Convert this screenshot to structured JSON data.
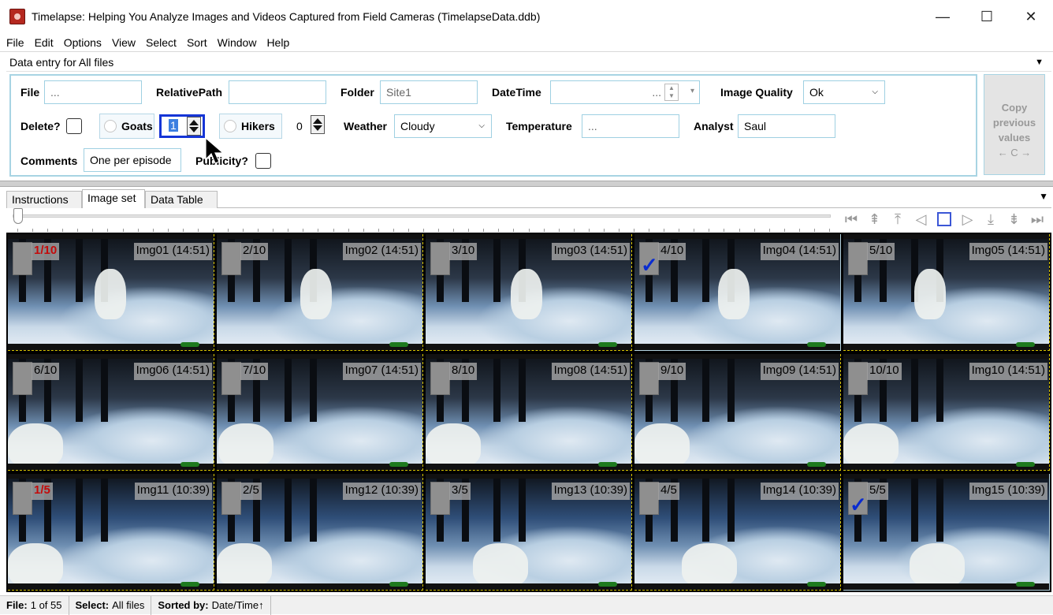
{
  "window": {
    "title": "Timelapse: Helping You Analyze Images and Videos Captured from Field Cameras (TimelapseData.ddb)",
    "controls": [
      "—",
      "☐",
      "✕"
    ]
  },
  "menu": [
    "File",
    "Edit",
    "Options",
    "View",
    "Select",
    "Sort",
    "Window",
    "Help"
  ],
  "data_entry": {
    "header": "Data entry for All files",
    "file": {
      "label": "File",
      "value": "..."
    },
    "relative_path": {
      "label": "RelativePath",
      "value": ""
    },
    "folder": {
      "label": "Folder",
      "value": "Site1"
    },
    "datetime": {
      "label": "DateTime",
      "value": "..."
    },
    "image_quality": {
      "label": "Image Quality",
      "value": "Ok"
    },
    "delete": {
      "label": "Delete?"
    },
    "goats": {
      "label": "Goats",
      "value": "1"
    },
    "hikers": {
      "label": "Hikers",
      "value": "0"
    },
    "weather": {
      "label": "Weather",
      "value": "Cloudy"
    },
    "temperature": {
      "label": "Temperature",
      "value": "..."
    },
    "analyst": {
      "label": "Analyst",
      "value": "Saul"
    },
    "comments": {
      "label": "Comments",
      "value": "One per episode"
    },
    "publicity": {
      "label": "Publicity?"
    },
    "copy_button": {
      "line1": "Copy",
      "line2": "previous",
      "line3": "values",
      "line4": "← C →"
    }
  },
  "tabs": [
    "Instructions",
    "Image set",
    "Data Table"
  ],
  "nav_icons": [
    "first-icon",
    "page-up-icon",
    "row-up-icon",
    "prev-icon",
    "stop-icon",
    "next-icon",
    "row-down-icon",
    "page-down-icon",
    "last-icon"
  ],
  "grid": {
    "cells": [
      {
        "frac": "1/10",
        "label": "Img01 (14:51)",
        "red": true,
        "checked": false
      },
      {
        "frac": "2/10",
        "label": "Img02 (14:51)",
        "red": false,
        "checked": false
      },
      {
        "frac": "3/10",
        "label": "Img03 (14:51)",
        "red": false,
        "checked": false
      },
      {
        "frac": "4/10",
        "label": "Img04 (14:51)",
        "red": false,
        "checked": true
      },
      {
        "frac": "5/10",
        "label": "Img05 (14:51)",
        "red": false,
        "checked": false
      },
      {
        "frac": "6/10",
        "label": "Img06 (14:51)",
        "red": false,
        "checked": false
      },
      {
        "frac": "7/10",
        "label": "Img07 (14:51)",
        "red": false,
        "checked": false
      },
      {
        "frac": "8/10",
        "label": "Img08 (14:51)",
        "red": false,
        "checked": false
      },
      {
        "frac": "9/10",
        "label": "Img09 (14:51)",
        "red": false,
        "checked": false
      },
      {
        "frac": "10/10",
        "label": "Img10 (14:51)",
        "red": false,
        "checked": false
      },
      {
        "frac": "1/5",
        "label": "Img11 (10:39)",
        "red": true,
        "checked": false
      },
      {
        "frac": "2/5",
        "label": "Img12 (10:39)",
        "red": false,
        "checked": false
      },
      {
        "frac": "3/5",
        "label": "Img13 (10:39)",
        "red": false,
        "checked": false
      },
      {
        "frac": "4/5",
        "label": "Img14 (10:39)",
        "red": false,
        "checked": false
      },
      {
        "frac": "5/5",
        "label": "Img15 (10:39)",
        "red": false,
        "checked": true
      }
    ]
  },
  "status": {
    "file_label": "File:",
    "file_value": "1 of 55",
    "select_label": "Select:",
    "select_value": "All files",
    "sorted_label": "Sorted by:",
    "sorted_value": "Date/Time↑"
  }
}
